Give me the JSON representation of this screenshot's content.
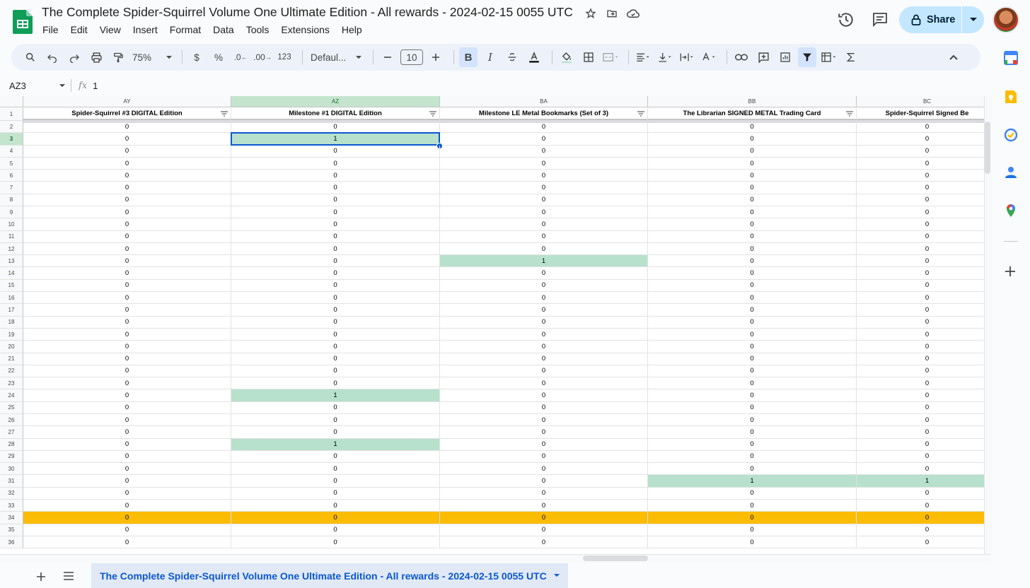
{
  "document": {
    "title": "The Complete Spider-Squirrel Volume One Ultimate Edition - All rewards - 2024-02-15 0055 UTC"
  },
  "menu": [
    "File",
    "Edit",
    "View",
    "Insert",
    "Format",
    "Data",
    "Tools",
    "Extensions",
    "Help"
  ],
  "share_label": "Share",
  "toolbar": {
    "zoom": "75%",
    "currency": "$",
    "percent": "%",
    "decrease_decimal": ".0",
    "increase_decimal": ".00",
    "number_format": "123",
    "font": "Defaul...",
    "font_size": "10",
    "bold": "B",
    "italic": "I"
  },
  "formula_bar": {
    "cell_ref": "AZ3",
    "fx": "fx",
    "value": "1"
  },
  "grid": {
    "columns": [
      {
        "letter": "AY",
        "header": "Spider-Squirrel #3 DIGITAL Edition"
      },
      {
        "letter": "AZ",
        "header": "Milestone #1 DIGITAL Edition"
      },
      {
        "letter": "BA",
        "header": "Milestone LE Metal Bookmarks (Set of 3)"
      },
      {
        "letter": "BB",
        "header": "The Librarian SIGNED METAL Trading Card"
      },
      {
        "letter": "BC",
        "header": "Spider-Squirrel Signed Be"
      }
    ],
    "rows": [
      {
        "num": "1"
      },
      {
        "num": "2",
        "values": [
          "0",
          "0",
          "0",
          "0",
          "0"
        ]
      },
      {
        "num": "3",
        "values": [
          "0",
          "1",
          "0",
          "0",
          "0"
        ]
      },
      {
        "num": "4",
        "values": [
          "0",
          "0",
          "0",
          "0",
          "0"
        ]
      },
      {
        "num": "5",
        "values": [
          "0",
          "0",
          "0",
          "0",
          "0"
        ]
      },
      {
        "num": "6",
        "values": [
          "0",
          "0",
          "0",
          "0",
          "0"
        ]
      },
      {
        "num": "7",
        "values": [
          "0",
          "0",
          "0",
          "0",
          "0"
        ]
      },
      {
        "num": "8",
        "values": [
          "0",
          "0",
          "0",
          "0",
          "0"
        ]
      },
      {
        "num": "9",
        "values": [
          "0",
          "0",
          "0",
          "0",
          "0"
        ]
      },
      {
        "num": "10",
        "values": [
          "0",
          "0",
          "0",
          "0",
          "0"
        ]
      },
      {
        "num": "11",
        "values": [
          "0",
          "0",
          "0",
          "0",
          "0"
        ]
      },
      {
        "num": "12",
        "values": [
          "0",
          "0",
          "0",
          "0",
          "0"
        ]
      },
      {
        "num": "13",
        "values": [
          "0",
          "0",
          "1",
          "0",
          "0"
        ]
      },
      {
        "num": "14",
        "values": [
          "0",
          "0",
          "0",
          "0",
          "0"
        ]
      },
      {
        "num": "15",
        "values": [
          "0",
          "0",
          "0",
          "0",
          "0"
        ]
      },
      {
        "num": "16",
        "values": [
          "0",
          "0",
          "0",
          "0",
          "0"
        ]
      },
      {
        "num": "17",
        "values": [
          "0",
          "0",
          "0",
          "0",
          "0"
        ]
      },
      {
        "num": "18",
        "values": [
          "0",
          "0",
          "0",
          "0",
          "0"
        ]
      },
      {
        "num": "19",
        "values": [
          "0",
          "0",
          "0",
          "0",
          "0"
        ]
      },
      {
        "num": "20",
        "values": [
          "0",
          "0",
          "0",
          "0",
          "0"
        ]
      },
      {
        "num": "21",
        "values": [
          "0",
          "0",
          "0",
          "0",
          "0"
        ]
      },
      {
        "num": "22",
        "values": [
          "0",
          "0",
          "0",
          "0",
          "0"
        ]
      },
      {
        "num": "23",
        "values": [
          "0",
          "0",
          "0",
          "0",
          "0"
        ]
      },
      {
        "num": "24",
        "values": [
          "0",
          "1",
          "0",
          "0",
          "0"
        ]
      },
      {
        "num": "25",
        "values": [
          "0",
          "0",
          "0",
          "0",
          "0"
        ]
      },
      {
        "num": "26",
        "values": [
          "0",
          "0",
          "0",
          "0",
          "0"
        ]
      },
      {
        "num": "27",
        "values": [
          "0",
          "0",
          "0",
          "0",
          "0"
        ]
      },
      {
        "num": "28",
        "values": [
          "0",
          "1",
          "0",
          "0",
          "0"
        ]
      },
      {
        "num": "29",
        "values": [
          "0",
          "0",
          "0",
          "0",
          "0"
        ]
      },
      {
        "num": "30",
        "values": [
          "0",
          "0",
          "0",
          "0",
          "0"
        ]
      },
      {
        "num": "31",
        "values": [
          "0",
          "0",
          "0",
          "1",
          "1"
        ]
      },
      {
        "num": "32",
        "values": [
          "0",
          "0",
          "0",
          "0",
          "0"
        ]
      },
      {
        "num": "33",
        "values": [
          "0",
          "0",
          "0",
          "0",
          "0"
        ]
      },
      {
        "num": "34",
        "values": [
          "0",
          "0",
          "0",
          "0",
          "0"
        ]
      },
      {
        "num": "35",
        "values": [
          "0",
          "0",
          "0",
          "0",
          "0"
        ]
      },
      {
        "num": "36",
        "values": [
          "0",
          "0",
          "0",
          "0",
          "0"
        ]
      }
    ],
    "highlighted_cells": [
      {
        "row": "3",
        "col": "AZ",
        "color": "#b7e1cd"
      },
      {
        "row": "13",
        "col": "BA",
        "color": "#b7e1cd"
      },
      {
        "row": "24",
        "col": "AZ",
        "color": "#b7e1cd"
      },
      {
        "row": "28",
        "col": "AZ",
        "color": "#b7e1cd"
      },
      {
        "row": "31",
        "col": "BB",
        "color": "#b7e1cd"
      },
      {
        "row": "31",
        "col": "BC",
        "color": "#b7e1cd"
      }
    ],
    "highlighted_row": {
      "row": "34",
      "color": "#fbbc04"
    },
    "selected_cell": "AZ3"
  },
  "sheet_tab": {
    "name": "The Complete Spider-Squirrel Volume One Ultimate Edition - All rewards - 2024-02-15 0055 UTC"
  },
  "colors": {
    "accent": "#0b57d0",
    "share_bg": "#c2e7ff",
    "toolbar_bg": "#edf2fa",
    "cell_green": "#b7e1cd",
    "row_orange": "#fbbc04"
  }
}
